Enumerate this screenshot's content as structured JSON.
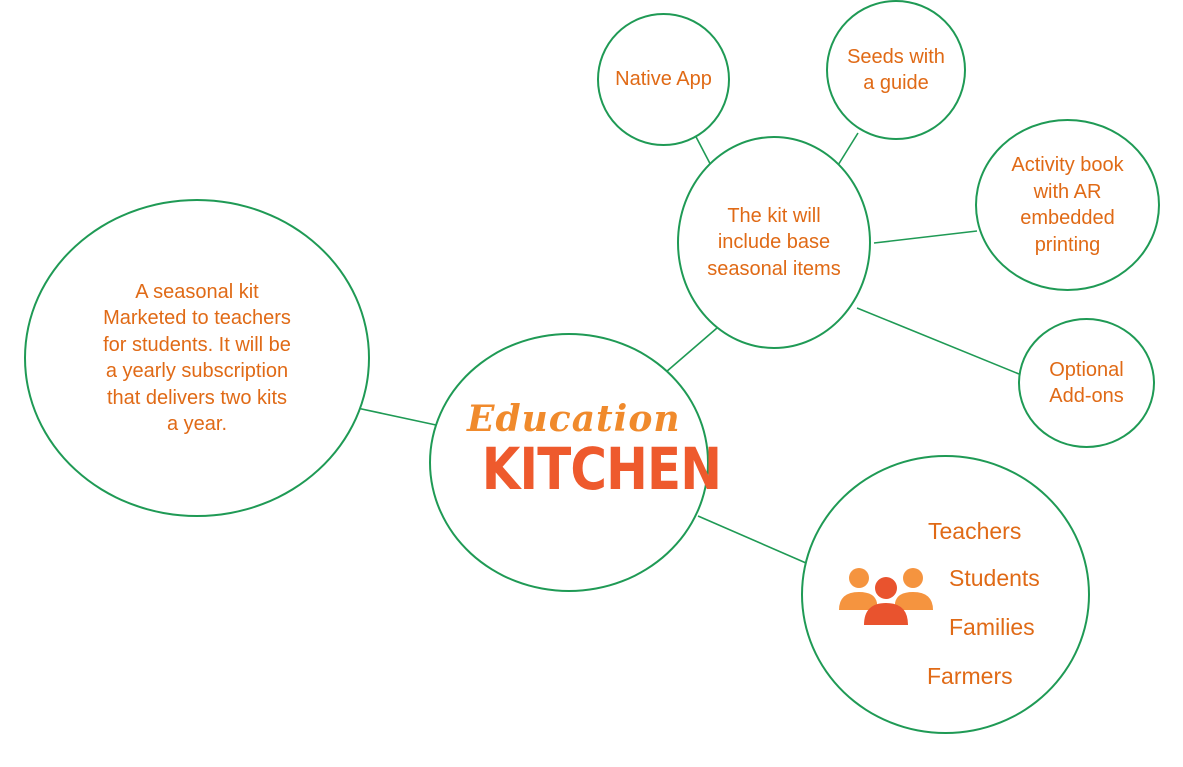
{
  "colors": {
    "line": "#1f9a55",
    "text": "#e06a16",
    "logo_script": "#f08a2c",
    "logo_main": "#ee5a2d",
    "icon_side": "#f5943f",
    "icon_center": "#e9532e"
  },
  "nodes": {
    "native_app": "Native App",
    "seeds": "Seeds with\na guide",
    "activity_book": "Activity book\nwith AR\nembedded\nprinting",
    "addons": "Optional\nAdd-ons",
    "kit": "The kit will\ninclude base\nseasonal items",
    "seasonal_kit": "A seasonal kit\nMarketed to teachers\nfor students. It will be\na yearly subscription\nthat delivers two kits\na year."
  },
  "logo": {
    "script": "Education",
    "main": "KITCHEN"
  },
  "audience": {
    "icon": "people-group-icon",
    "items": [
      "Teachers",
      "Students",
      "Families",
      "Farmers"
    ]
  }
}
